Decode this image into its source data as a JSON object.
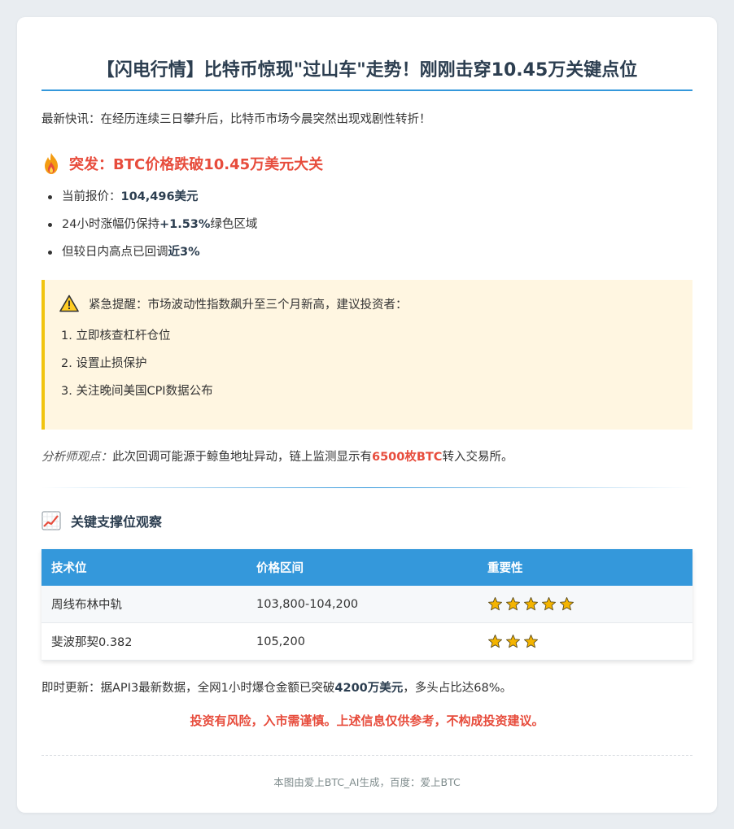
{
  "title": "【闪电行情】比特币惊现\"过山车\"走势！刚刚击穿10.45万关键点位",
  "intro": "最新快讯：在经历连续三日攀升后，比特币市场今晨突然出现戏剧性转折！",
  "breaking": {
    "icon": "fire-icon",
    "heading": "突发：BTC价格跌破10.45万美元大关"
  },
  "bullets": [
    {
      "pre": "当前报价：",
      "strong": "104,496美元",
      "post": ""
    },
    {
      "pre": "24小时涨幅仍保持",
      "strong": "+1.53%",
      "post": "绿色区域"
    },
    {
      "pre": "但较日内高点已回调",
      "strong": "近3%",
      "post": ""
    }
  ],
  "alert": {
    "icon": "warning-icon",
    "text": "紧急提醒：市场波动性指数飙升至三个月新高，建议投资者：",
    "steps": [
      "1. 立即核查杠杆仓位",
      "2. 设置止损保护",
      "3. 关注晚间美国CPI数据公布"
    ]
  },
  "analyst": {
    "label": "分析师观点：",
    "pre": "此次回调可能源于鲸鱼地址异动，链上监测显示有",
    "highlight": "6500枚BTC",
    "post": "转入交易所。"
  },
  "support": {
    "icon": "chart-icon",
    "heading": "关键支撑位观察",
    "columns": [
      "技术位",
      "价格区间",
      "重要性"
    ],
    "rows": [
      {
        "level": "周线布林中轨",
        "range": "103,800-104,200",
        "stars": 5
      },
      {
        "level": "斐波那契0.382",
        "range": "105,200",
        "stars": 3
      }
    ]
  },
  "update": {
    "pre": "即时更新：据API3最新数据，全网1小时爆仓金额已突破",
    "strong": "4200万美元",
    "post": "，多头占比达68%。"
  },
  "disclaimer": "投资有风险，入市需谨慎。上述信息仅供参考，不构成投资建议。",
  "footer": "本图由爱上BTC_AI生成，百度：爱上BTC",
  "colors": {
    "accent": "#3498db",
    "alert": "#e74c3c",
    "warning_bg": "#fff6e1",
    "warning_border": "#f1c40f",
    "star": "#f4b400"
  }
}
